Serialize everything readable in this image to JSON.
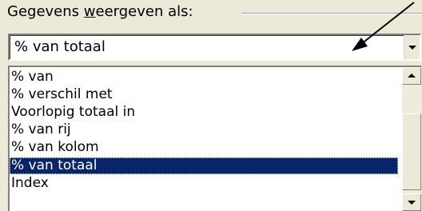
{
  "group": {
    "label_before": "Gegevens ",
    "label_underlined": "w",
    "label_after": "eergeven als:"
  },
  "combo": {
    "value": "% van totaal"
  },
  "list": {
    "items": [
      {
        "label": "% van"
      },
      {
        "label": "% verschil met"
      },
      {
        "label": "Voorlopig totaal in"
      },
      {
        "label": "% van rij"
      },
      {
        "label": "% van kolom"
      },
      {
        "label": "% van totaal",
        "selected": true
      },
      {
        "label": "Index"
      }
    ]
  },
  "colors": {
    "selection": "#0a246a",
    "annotation_arrow": "#000000"
  }
}
